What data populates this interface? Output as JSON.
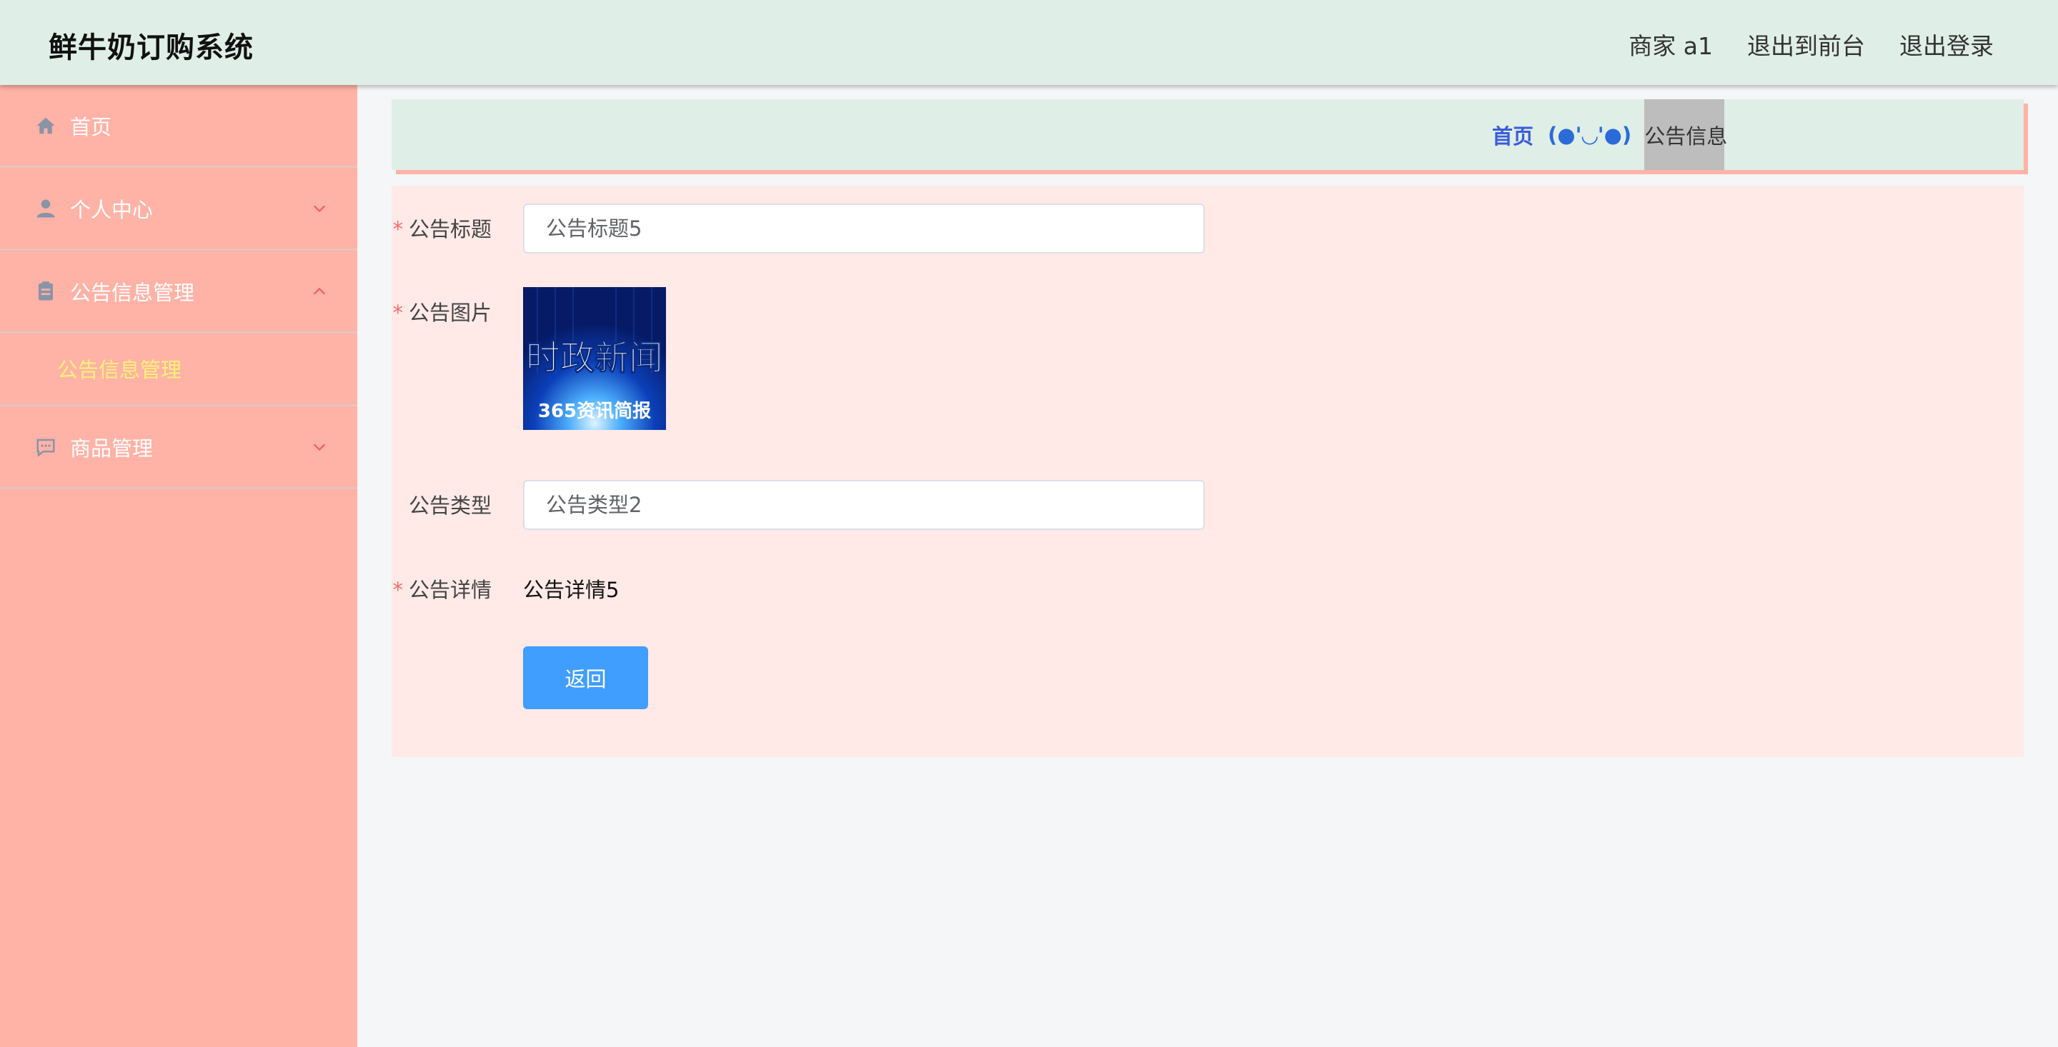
{
  "header": {
    "title": "鲜牛奶订购系统",
    "user": "商家 a1",
    "to_front": "退出到前台",
    "logout": "退出登录"
  },
  "sidebar": {
    "items": [
      {
        "label": "首页",
        "icon": "home-icon"
      },
      {
        "label": "个人中心",
        "icon": "user-icon",
        "chevron": "down"
      },
      {
        "label": "公告信息管理",
        "icon": "clipboard-icon",
        "chevron": "up",
        "expanded": true
      },
      {
        "label": "商品管理",
        "icon": "chat-icon",
        "chevron": "down"
      }
    ],
    "submenu": {
      "label": "公告信息管理"
    }
  },
  "breadcrumb": {
    "home": "首页",
    "separator": "(●'◡'●)",
    "current": "公告信息"
  },
  "form": {
    "title_label": "公告标题",
    "title_value": "公告标题5",
    "image_label": "公告图片",
    "image_text_main": "时政新闻",
    "image_text_sub": "365资讯简报",
    "type_label": "公告类型",
    "type_value": "公告类型2",
    "detail_label": "公告详情",
    "detail_value": "公告详情5",
    "back_label": "返回",
    "required_mark": "*"
  },
  "colors": {
    "header_bg": "#dfeee7",
    "sidebar_bg": "#ffb2a6",
    "submenu_active": "#fff176",
    "panel_bg": "#ffeae7",
    "primary": "#409eff"
  }
}
